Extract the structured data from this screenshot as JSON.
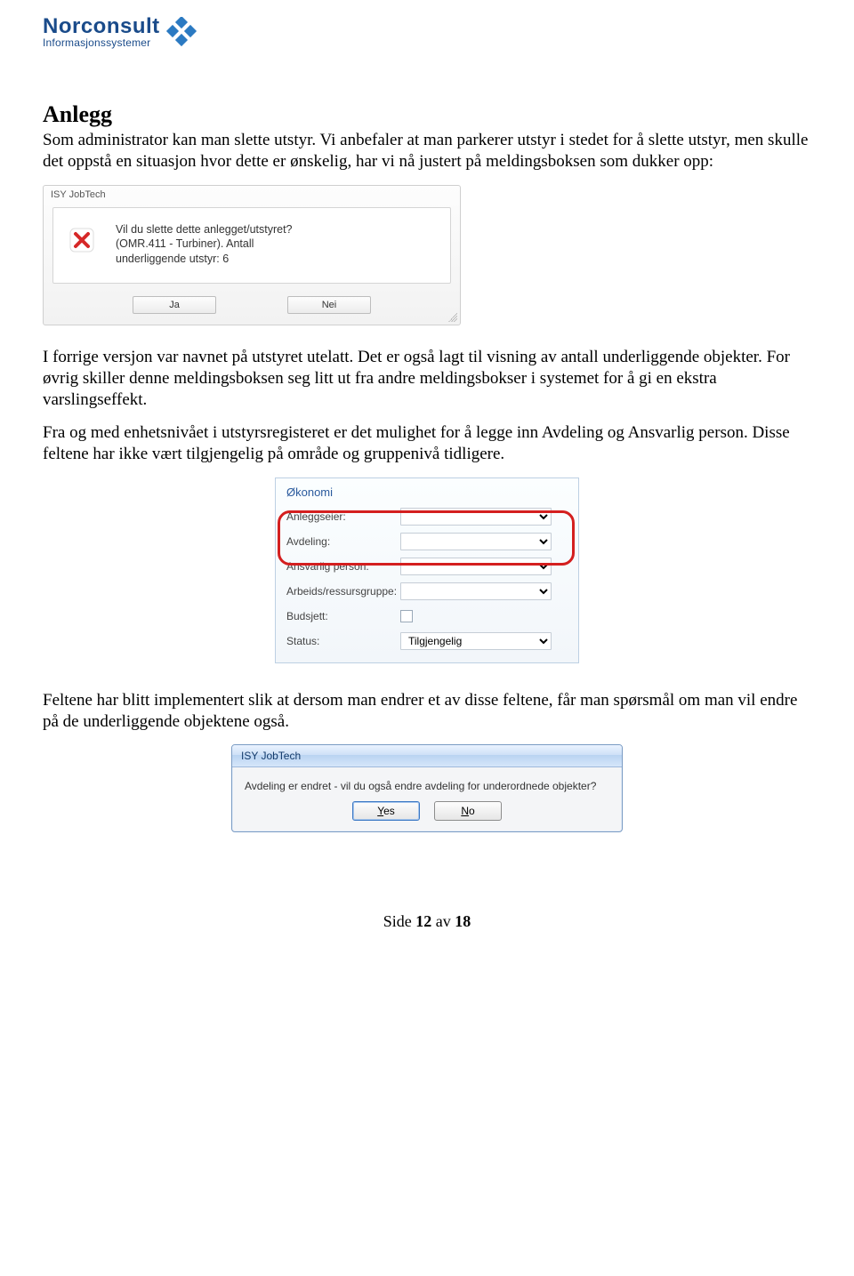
{
  "logo": {
    "main": "Norconsult",
    "sub": "Informasjonssystemer"
  },
  "section": {
    "title": "Anlegg",
    "para1": "Som administrator kan man slette utstyr. Vi anbefaler at man parkerer utstyr i stedet for å slette utstyr, men skulle det oppstå en situasjon hvor dette er ønskelig, har vi nå justert på meldingsboksen som dukker opp:",
    "para2": "I forrige versjon var navnet på utstyret utelatt. Det er også lagt til visning av antall underliggende objekter. For øvrig skiller denne meldingsboksen seg litt ut fra andre meldingsbokser i systemet for å gi en ekstra varslingseffekt.",
    "para3": "Fra og med enhetsnivået i utstyrsregisteret er det mulighet for å legge inn Avdeling og Ansvarlig person. Disse feltene har ikke vært tilgjengelig på område og gruppenivå tidligere.",
    "para4": "Feltene har blitt implementert slik at dersom man endrer et av disse feltene, får man spørsmål om man vil endre på de underliggende objektene også."
  },
  "dialog1": {
    "title": "ISY JobTech",
    "msg_line1": "Vil du slette dette anlegget/utstyret?",
    "msg_line2": "(OMR.411 - Turbiner). Antall",
    "msg_line3": "underliggende utstyr: 6",
    "yes": "Ja",
    "no": "Nei"
  },
  "form": {
    "title": "Økonomi",
    "rows": {
      "anleggseier": "Anleggseier:",
      "avdeling": "Avdeling:",
      "ansvarlig": "Ansvarlig person:",
      "arbeids": "Arbeids/ressursgruppe:",
      "budsjett": "Budsjett:",
      "status": "Status:"
    },
    "status_value": "Tilgjengelig"
  },
  "dialog2": {
    "title": "ISY JobTech",
    "msg": "Avdeling er endret - vil du også endre avdeling for underordnede objekter?",
    "yes_u": "Y",
    "yes_rest": "es",
    "no_u": "N",
    "no_rest": "o"
  },
  "footer": {
    "prefix": "Side ",
    "current": "12",
    "sep": " av ",
    "total": "18"
  }
}
